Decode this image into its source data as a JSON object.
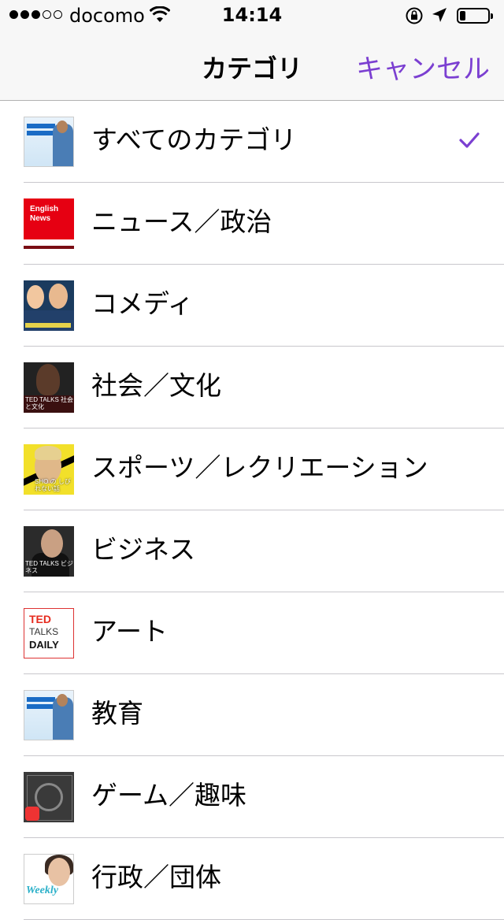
{
  "status_bar": {
    "signal_bars_filled": 3,
    "signal_bars_total": 5,
    "carrier": "docomo",
    "time": "14:14",
    "battery_level": 0.2
  },
  "nav": {
    "title": "カテゴリ",
    "cancel_label": "キャンセル",
    "accent_color": "#7b3fd1"
  },
  "categories": [
    {
      "label": "すべてのカテゴリ",
      "thumb": "native-english-podcast",
      "selected": true
    },
    {
      "label": "ニュース／政治",
      "thumb": "nhk-english-news"
    },
    {
      "label": "コメディ",
      "thumb": "comedy-podcast"
    },
    {
      "label": "社会／文化",
      "thumb": "ted-talks-society"
    },
    {
      "label": "スポーツ／レクリエーション",
      "thumb": "sho-podcast"
    },
    {
      "label": "ビジネス",
      "thumb": "ted-talks-business"
    },
    {
      "label": "アート",
      "thumb": "ted-talks-daily"
    },
    {
      "label": "教育",
      "thumb": "native-english-podcast"
    },
    {
      "label": "ゲーム／趣味",
      "thumb": "game-podcast"
    },
    {
      "label": "行政／団体",
      "thumb": "weekly-podcast"
    }
  ],
  "thumb_text": {
    "nhk": "English News",
    "ted_society": "TED TALKS 社会と文化",
    "sho": "SHO の しびれない話",
    "ted_business": "TED TALKS ビジネス",
    "ted_daily_1": "TED",
    "ted_daily_2": "TALKS",
    "ted_daily_3": "DAILY",
    "weekly": "Weekly"
  }
}
